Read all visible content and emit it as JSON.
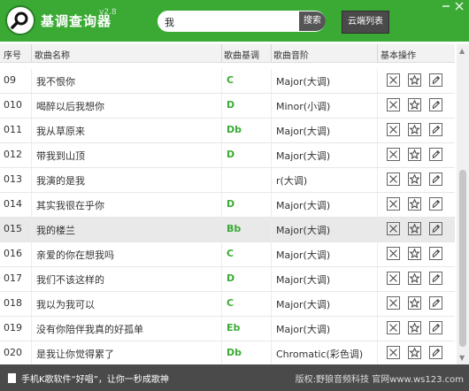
{
  "app": {
    "title": "基调查询器",
    "version": "v2.8",
    "search_value": "我",
    "search_label": "搜索",
    "cloud_label": "云端列表"
  },
  "table": {
    "headers": [
      "序号",
      "歌曲名称",
      "歌曲基调",
      "歌曲音阶",
      "基本操作"
    ],
    "rows": [
      {
        "no": "09",
        "name": "我不恨你",
        "key": "C",
        "scale": "Major(大调)"
      },
      {
        "no": "010",
        "name": "喝醉以后我想你",
        "key": "D",
        "scale": "Minor(小调)"
      },
      {
        "no": "011",
        "name": "我从草原来",
        "key": "Db",
        "scale": "Major(大调)"
      },
      {
        "no": "012",
        "name": "带我到山顶",
        "key": "D",
        "scale": "Major(大调)"
      },
      {
        "no": "013",
        "name": "我演的是我",
        "key": "",
        "scale": "r(大调)"
      },
      {
        "no": "014",
        "name": "其实我很在乎你",
        "key": "D",
        "scale": "Major(大调)"
      },
      {
        "no": "015",
        "name": "我的楼兰",
        "key": "Bb",
        "scale": "Major(大调)"
      },
      {
        "no": "016",
        "name": "亲爱的你在想我吗",
        "key": "C",
        "scale": "Major(大调)"
      },
      {
        "no": "017",
        "name": "我们不该这样的",
        "key": "D",
        "scale": "Major(大调)"
      },
      {
        "no": "018",
        "name": "我以为我可以",
        "key": "C",
        "scale": "Major(大调)"
      },
      {
        "no": "019",
        "name": "没有你陪伴我真的好孤单",
        "key": "Eb",
        "scale": "Major(大调)"
      },
      {
        "no": "020",
        "name": "是我让你觉得累了",
        "key": "Db",
        "scale": "Chromatic(彩色调)"
      }
    ],
    "selected_index": 6
  },
  "footer": {
    "text": "手机K歌软件“好唱”，让你一秒成歌神",
    "credit": "版权:野狼音频科技 官网www.ws123.com"
  },
  "colors": {
    "brand": "#3aaa35",
    "footer": "#4a4a4a"
  }
}
